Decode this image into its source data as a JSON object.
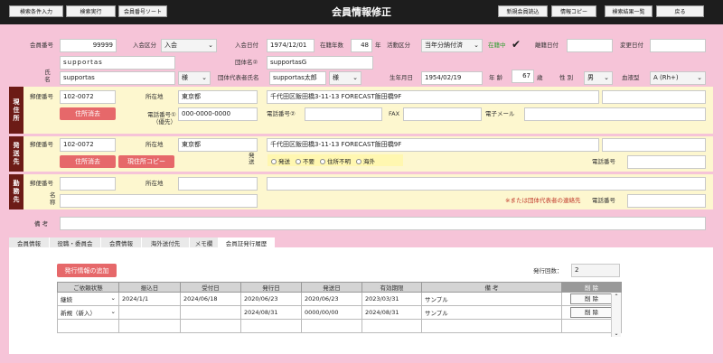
{
  "toolbar": {
    "search_input": "検索条件入力",
    "search_exec": "検索実行",
    "sort": "会員番号ソート",
    "new_load": "新規会員読込",
    "copy": "情報コピー",
    "results": "検索結果一覧",
    "back": "戻る"
  },
  "page_title": "会員情報修正",
  "member": {
    "no_label": "会員番号",
    "no": "99999",
    "category_label": "入会区分",
    "category": "入会",
    "join_date_label": "入会日付",
    "join_date": "1974/12/01",
    "years_label": "在籍年数",
    "years": "48",
    "years_unit": "年",
    "activity_label": "活動区分",
    "activity": "当年分納付済",
    "status": "在籍中",
    "withdraw_label": "離籍日付",
    "withdraw": "",
    "change_label": "変更日付",
    "change": "",
    "furigana": "supportas",
    "org_name_label": "団体名②",
    "org_name": "supportasG",
    "name_label": "氏名",
    "name": "supportas",
    "honorific": "様",
    "rep_label": "団体代表者氏名",
    "rep_name": "supportas太郎",
    "rep_honorific": "様",
    "birth_label": "生年月日",
    "birth": "1954/02/19",
    "age_label": "年 齢",
    "age": "67",
    "age_unit": "歳",
    "sex_label": "性 別",
    "sex": "男",
    "blood_label": "血液型",
    "blood": "A (Rh+)"
  },
  "home": {
    "tag": "現住所",
    "zip_label": "郵便番号",
    "zip": "102-0072",
    "city_label": "所在地",
    "city": "東京都",
    "address": "千代田区飯田橋3-11-13 FORECAST飯田橋9F",
    "clear_btn": "住所消去",
    "tel1_label": "電話番号①（優先）",
    "tel1": "000-0000-0000",
    "tel2_label": "電話番号②",
    "fax_label": "FAX",
    "email_label": "電子メール"
  },
  "ship": {
    "tag": "発送先",
    "zip_label": "郵便番号",
    "zip": "102-0072",
    "city_label": "所在地",
    "city": "東京都",
    "address": "千代田区飯田橋3-11-13 FORECAST飯田橋9F",
    "clear_btn": "住所消去",
    "copy_btn": "現住所コピー",
    "kind_label": "発送",
    "options": [
      "発送",
      "不要",
      "住所不明",
      "海外"
    ],
    "tel_label": "電話番号"
  },
  "work": {
    "tag": "勤務先",
    "zip_label": "郵便番号",
    "city_label": "所在地",
    "name_label": "名称",
    "note": "※または団体代表者の連絡先",
    "tel_label": "電話番号"
  },
  "remarks_label": "備 考",
  "tabs": [
    "会員情報",
    "役職・委員会",
    "会費情報",
    "海外送付先",
    "メモ欄",
    "会員証発行履歴"
  ],
  "history": {
    "add_btn": "発行情報の追加",
    "count_label": "発行回数：",
    "count": "2",
    "columns": [
      "ご依頼状態",
      "振込日",
      "受付日",
      "発行日",
      "発送日",
      "有効期限",
      "備 考",
      "削 除"
    ],
    "rows": [
      {
        "status": "継続",
        "paid": "2024/1/1",
        "received": "2024/06/18",
        "issued": "2020/06/23",
        "sent": "2020/06/23",
        "expiry": "2023/03/31",
        "note": "サンプル",
        "del": "削 除"
      },
      {
        "status": "新規（新入）",
        "paid": "",
        "received": "",
        "issued": "2024/08/31",
        "sent": "0000/00/00",
        "expiry": "2024/08/31",
        "note": "サンプル",
        "del": "削 除"
      }
    ]
  }
}
